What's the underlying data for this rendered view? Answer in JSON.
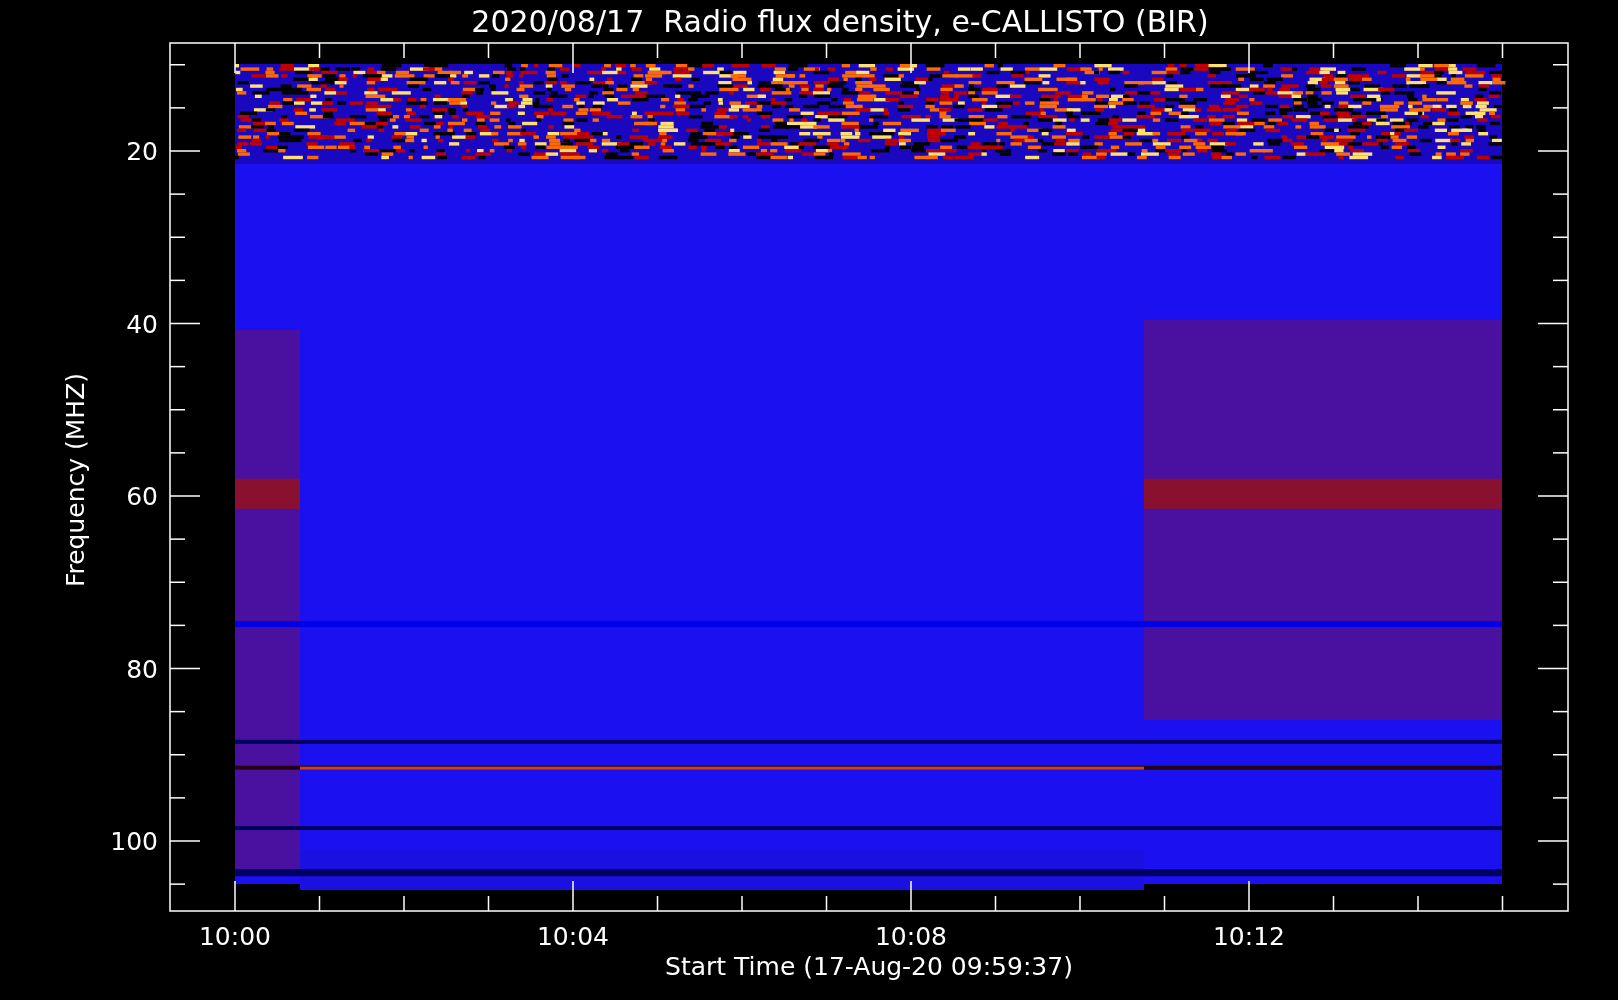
{
  "title": "2020/08/17  Radio flux density, e-CALLISTO (BIR)",
  "plot": {
    "ylabel": "Frequency (MHZ)",
    "xlabel": "Start Time (17-Aug-20 09:59:37)",
    "yticks": [
      "20",
      "40",
      "60",
      "80",
      "100"
    ],
    "xticks": [
      "10:00",
      "10:04",
      "10:08",
      "10:12"
    ]
  }
}
